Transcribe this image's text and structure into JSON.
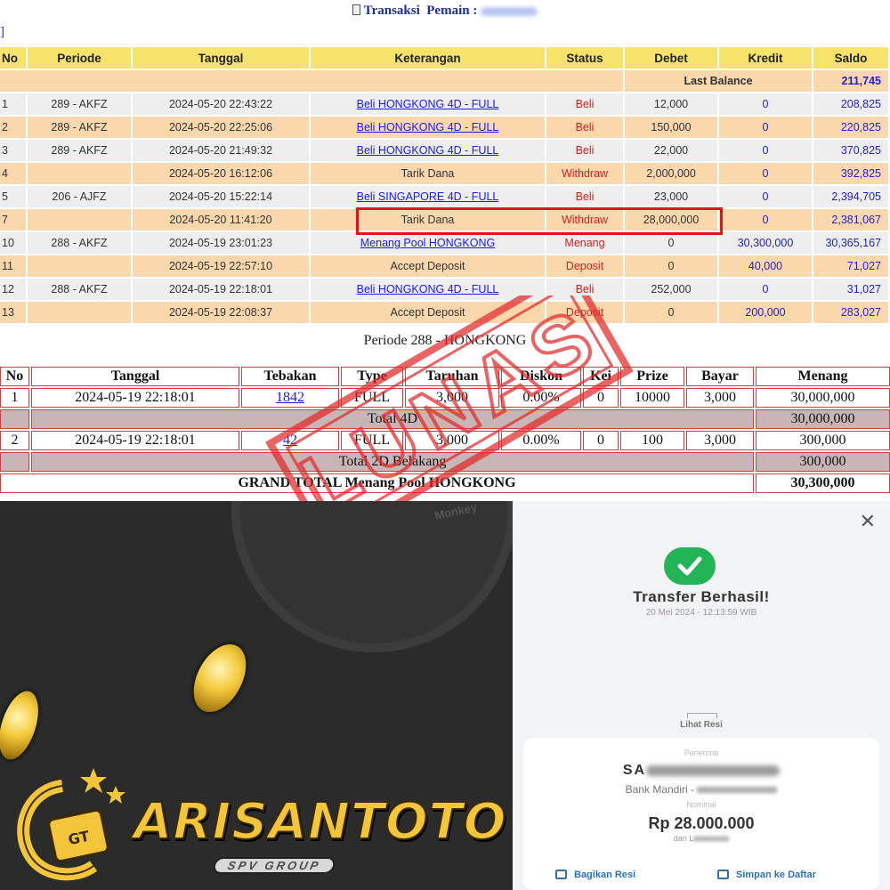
{
  "header": {
    "title_prefix": "Transaksi",
    "player_label": "Pemain :",
    "back_link": "]"
  },
  "tx_table": {
    "columns": [
      "No",
      "Periode",
      "Tanggal",
      "Keterangan",
      "Status",
      "Debet",
      "Kredit",
      "Saldo"
    ],
    "last_balance_label": "Last Balance",
    "last_balance_value": "211,745",
    "rows": [
      {
        "no": "1",
        "periode": "289 - AKFZ",
        "tanggal": "2024-05-20 22:43:22",
        "ket": "Beli HONGKONG 4D - FULL",
        "link": true,
        "status": "Beli",
        "debet": "12,000",
        "kredit": "0",
        "saldo": "208,825"
      },
      {
        "no": "2",
        "periode": "289 - AKFZ",
        "tanggal": "2024-05-20 22:25:06",
        "ket": "Beli HONGKONG 4D - FULL",
        "link": true,
        "status": "Beli",
        "debet": "150,000",
        "kredit": "0",
        "saldo": "220,825"
      },
      {
        "no": "3",
        "periode": "289 - AKFZ",
        "tanggal": "2024-05-20 21:49:32",
        "ket": "Beli HONGKONG 4D - FULL",
        "link": true,
        "status": "Beli",
        "debet": "22,000",
        "kredit": "0",
        "saldo": "370,825"
      },
      {
        "no": "4",
        "periode": "",
        "tanggal": "2024-05-20 16:12:06",
        "ket": "Tarik Dana",
        "link": false,
        "status": "Withdraw",
        "debet": "2,000,000",
        "kredit": "0",
        "saldo": "392,825"
      },
      {
        "no": "5",
        "periode": "206 - AJFZ",
        "tanggal": "2024-05-20 15:22:14",
        "ket": "Beli SINGAPORE 4D - FULL",
        "link": true,
        "status": "Beli",
        "debet": "23,000",
        "kredit": "0",
        "saldo": "2,394,705"
      },
      {
        "no": "7",
        "periode": "",
        "tanggal": "2024-05-20 11:41:20",
        "ket": "Tarik Dana",
        "link": false,
        "status": "Withdraw",
        "debet": "28,000,000",
        "kredit": "0",
        "saldo": "2,381,067"
      },
      {
        "no": "10",
        "periode": "288 - AKFZ",
        "tanggal": "2024-05-19 23:01:23",
        "ket": "Menang Pool HONGKONG",
        "link": true,
        "status": "Menang",
        "debet": "0",
        "kredit": "30,300,000",
        "saldo": "30,365,167"
      },
      {
        "no": "11",
        "periode": "",
        "tanggal": "2024-05-19 22:57:10",
        "ket": "Accept Deposit",
        "link": false,
        "status": "Deposit",
        "debet": "0",
        "kredit": "40,000",
        "saldo": "71,027"
      },
      {
        "no": "12",
        "periode": "288 - AKFZ",
        "tanggal": "2024-05-19 22:18:01",
        "ket": "Beli HONGKONG 4D - FULL",
        "link": true,
        "status": "Beli",
        "debet": "252,000",
        "kredit": "0",
        "saldo": "31,027"
      },
      {
        "no": "13",
        "periode": "",
        "tanggal": "2024-05-19 22:08:37",
        "ket": "Accept Deposit",
        "link": false,
        "status": "Deposit",
        "debet": "0",
        "kredit": "200,000",
        "saldo": "283,027"
      }
    ]
  },
  "detail": {
    "title": "Periode 288 - HONGKONG",
    "columns": [
      "No",
      "Tanggal",
      "Tebakan",
      "Type",
      "Taruhan",
      "Diskon",
      "Kei",
      "Prize",
      "Bayar",
      "Menang"
    ],
    "row1": {
      "no": "1",
      "tanggal": "2024-05-19 22:18:01",
      "tebakan": "1842",
      "type": "FULL",
      "taruhan": "3,000",
      "diskon": "0.00%",
      "kei": "0",
      "prize": "10000",
      "bayar": "3,000",
      "menang": "30,000,000"
    },
    "total1_label": "Total 4D",
    "total1_value": "30,000,000",
    "row2": {
      "no": "2",
      "tanggal": "2024-05-19 22:18:01",
      "tebakan": "42",
      "type": "FULL",
      "taruhan": "3,000",
      "diskon": "0.00%",
      "kei": "0",
      "prize": "100",
      "bayar": "3,000",
      "menang": "300,000"
    },
    "total2_label": "Total 2D Belakang",
    "total2_value": "300,000",
    "grand_label": "GRAND TOTAL  Menang Pool HONGKONG",
    "grand_value": "30,300,000"
  },
  "stamp": {
    "text": "LUNAS"
  },
  "promo": {
    "wheel_label": "Monkey",
    "logo_text": "ARISANTOTO",
    "logo_sub": "SPV GROUP"
  },
  "receipt": {
    "title": "Transfer Berhasil!",
    "date": "20 Mei 2024 - 12:13:59 WIB",
    "lihat_resi": "Lihat Resi",
    "penerima_label": "Penerima",
    "name_visible": "SA",
    "bank": "Bank Mandiri -",
    "nominal_label": "Nominal",
    "amount": "Rp 28.000.000",
    "dari": "dari L",
    "share": "Bagikan Resi",
    "save": "Simpan ke Daftar",
    "accent": "#22b457"
  }
}
